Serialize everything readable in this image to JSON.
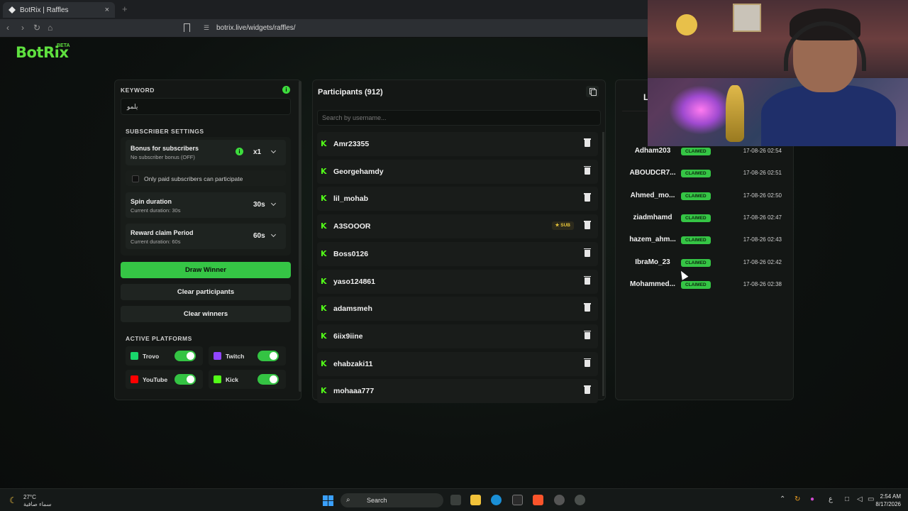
{
  "browser": {
    "tab_title": "BotRix | Raffles",
    "tab_close": "×",
    "new_tab": "+",
    "url": "botrix.live/widgets/raffles/"
  },
  "logo": {
    "name": "BotRix",
    "badge": "BETA"
  },
  "settings": {
    "keyword_label": "KEYWORD",
    "keyword_value": "يلمو",
    "subscriber_settings_label": "SUBSCRIBER SETTINGS",
    "bonus_title": "Bonus for subscribers",
    "bonus_sub": "No subscriber bonus (OFF)",
    "bonus_value": "x1",
    "paid_only_label": "Only paid subscribers can participate",
    "spin_title": "Spin duration",
    "spin_sub": "Current duration: 30s",
    "spin_value": "30s",
    "claim_title": "Reward claim Period",
    "claim_sub": "Current duration: 60s",
    "claim_value": "60s",
    "draw_winner": "Draw Winner",
    "clear_participants": "Clear participants",
    "clear_winners": "Clear winners",
    "active_platforms_label": "ACTIVE PLATFORMS",
    "platforms": [
      {
        "name": "Trovo",
        "color": "#19d66b",
        "enabled": true
      },
      {
        "name": "Twitch",
        "color": "#9146ff",
        "enabled": true
      },
      {
        "name": "YouTube",
        "color": "#ff0000",
        "enabled": true
      },
      {
        "name": "Kick",
        "color": "#53fc18",
        "enabled": true
      }
    ]
  },
  "participants": {
    "title": "Participants (912)",
    "search_placeholder": "Search by username...",
    "sub_badge": "SUB",
    "list": [
      {
        "name": "Amr23355",
        "sub": false
      },
      {
        "name": "Georgehamdy",
        "sub": false
      },
      {
        "name": "lil_mohab",
        "sub": false
      },
      {
        "name": "A3SOOOR",
        "sub": true
      },
      {
        "name": "Boss0126",
        "sub": false
      },
      {
        "name": "yaso124861",
        "sub": false
      },
      {
        "name": "adamsmeh",
        "sub": false
      },
      {
        "name": "6iix9iine",
        "sub": false
      },
      {
        "name": "ehabzaki11",
        "sub": false
      },
      {
        "name": "mohaaa777",
        "sub": false
      }
    ]
  },
  "winners": {
    "header_initial": "L",
    "status_label": "CLAIMED",
    "list": [
      {
        "name": "Adham203",
        "time": "17-08-26 02:54"
      },
      {
        "name": "ABOUDCR7...",
        "time": "17-08-26 02:51"
      },
      {
        "name": "Ahmed_mo...",
        "time": "17-08-26 02:50"
      },
      {
        "name": "ziadmhamd",
        "time": "17-08-26 02:47"
      },
      {
        "name": "hazem_ahm...",
        "time": "17-08-26 02:43"
      },
      {
        "name": "IbraMo_23",
        "time": "17-08-26 02:42"
      },
      {
        "name": "Mohammed...",
        "time": "17-08-26 02:38"
      }
    ]
  },
  "taskbar": {
    "temperature": "27°C",
    "weather": "سماء صافية",
    "search": "Search",
    "lang": "ع",
    "time": "2:54 AM",
    "date": "8/17/2026"
  }
}
